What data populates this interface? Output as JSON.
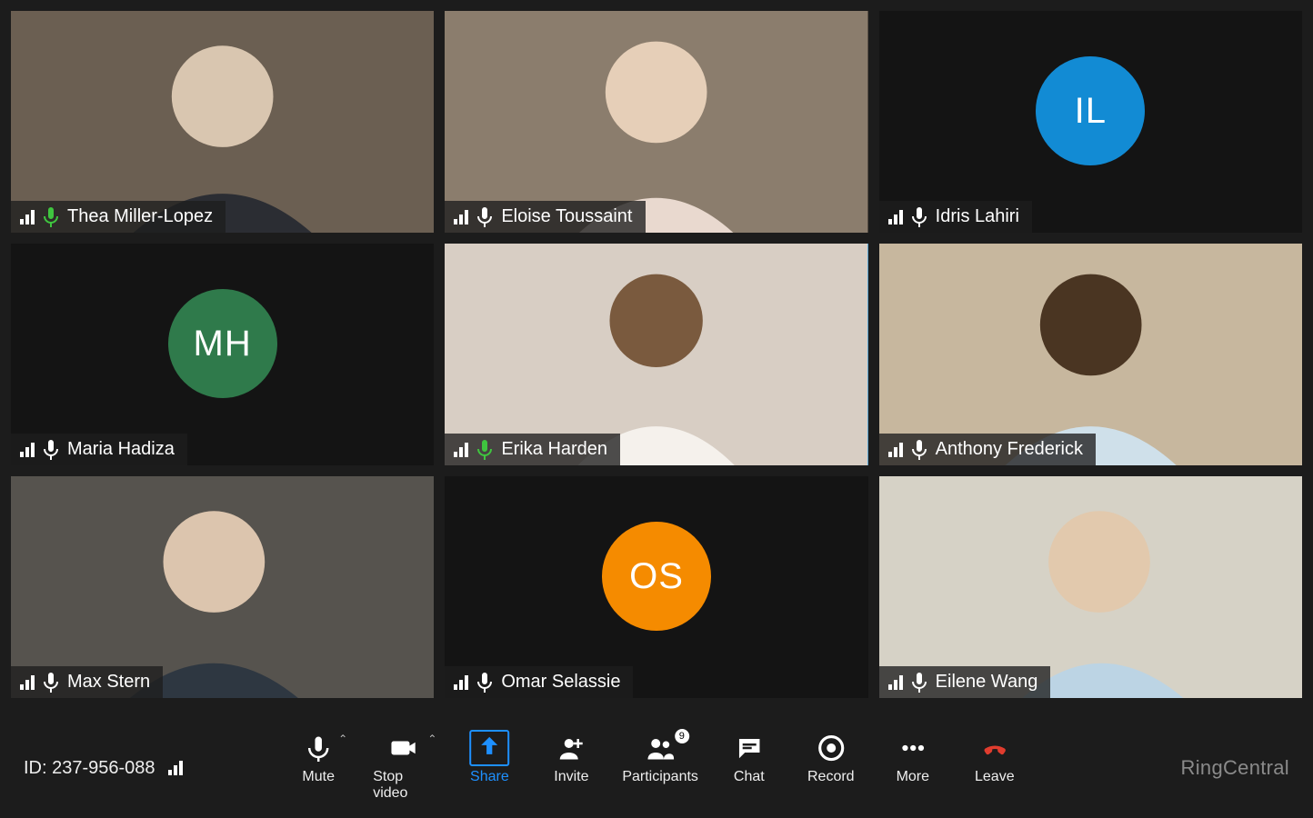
{
  "participants": [
    {
      "name": "Thea Miller-Lopez",
      "video": true,
      "avatar_bg": null,
      "initials": "",
      "border": "green",
      "mic_color": "green"
    },
    {
      "name": "Eloise Toussaint",
      "video": true,
      "avatar_bg": null,
      "initials": "",
      "border": null,
      "mic_color": "white"
    },
    {
      "name": "Idris Lahiri",
      "video": false,
      "avatar_bg": "blue",
      "initials": "IL",
      "border": null,
      "mic_color": "white"
    },
    {
      "name": "Maria Hadiza",
      "video": false,
      "avatar_bg": "green",
      "initials": "MH",
      "border": null,
      "mic_color": "white"
    },
    {
      "name": "Erika Harden",
      "video": true,
      "avatar_bg": null,
      "initials": "",
      "border": "blue",
      "mic_color": "green"
    },
    {
      "name": "Anthony Frederick",
      "video": true,
      "avatar_bg": null,
      "initials": "",
      "border": null,
      "mic_color": "white"
    },
    {
      "name": "Max Stern",
      "video": true,
      "avatar_bg": null,
      "initials": "",
      "border": null,
      "mic_color": "white"
    },
    {
      "name": "Omar Selassie",
      "video": false,
      "avatar_bg": "orange",
      "initials": "OS",
      "border": null,
      "mic_color": "white"
    },
    {
      "name": "Eilene Wang",
      "video": true,
      "avatar_bg": null,
      "initials": "",
      "border": null,
      "mic_color": "white"
    }
  ],
  "footer": {
    "meeting_id_label": "ID: 237-956-088",
    "controls": {
      "mute": {
        "label": "Mute"
      },
      "stop_video": {
        "label": "Stop video"
      },
      "share": {
        "label": "Share"
      },
      "invite": {
        "label": "Invite"
      },
      "participants": {
        "label": "Participants",
        "count": "9"
      },
      "chat": {
        "label": "Chat"
      },
      "record": {
        "label": "Record"
      },
      "more": {
        "label": "More"
      },
      "leave": {
        "label": "Leave"
      }
    },
    "brand": "RingCentral"
  }
}
